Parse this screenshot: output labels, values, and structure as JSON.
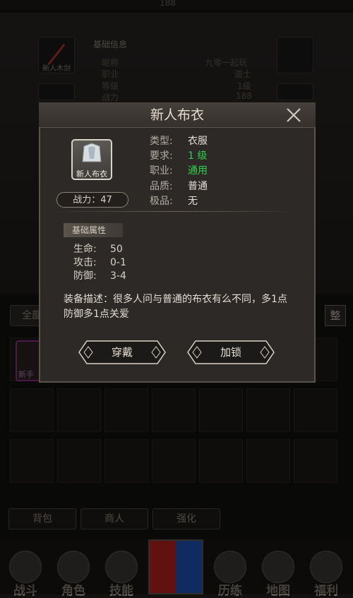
{
  "background": {
    "topbar_number": "188",
    "info_heading": "基础信息",
    "info_rows": [
      {
        "label": "昵称",
        "value": "九零一起玩"
      },
      {
        "label": "职业",
        "value": "道士"
      },
      {
        "label": "等级",
        "value": "1级"
      },
      {
        "label": "战力",
        "value": "188"
      }
    ],
    "weapon_slot_label": "新人木剑",
    "filter_button": "全部",
    "sort_button": "整",
    "bag_item_label": "新手",
    "tabs": [
      "背包",
      "商人",
      "强化"
    ],
    "nav": [
      "战斗",
      "角色",
      "技能",
      "历练",
      "地图",
      "福利"
    ]
  },
  "modal": {
    "title": "新人布衣",
    "item_icon_label": "新人布衣",
    "power": "战力：47",
    "properties": [
      {
        "key": "类型:",
        "value": "衣服",
        "highlight": false
      },
      {
        "key": "要求:",
        "value": "1 级",
        "highlight": true
      },
      {
        "key": "职业:",
        "value": "通用",
        "highlight": true
      },
      {
        "key": "品质:",
        "value": "普通",
        "highlight": false
      },
      {
        "key": "极品:",
        "value": "无",
        "highlight": false
      }
    ],
    "attributes_title": "基础属性",
    "attributes": [
      {
        "key": "生命:",
        "value": "50"
      },
      {
        "key": "攻击:",
        "value": "0-1"
      },
      {
        "key": "防御:",
        "value": "3-4"
      }
    ],
    "description": "装备描述：很多人问与普通的布衣有么不同，多1点防御多1点关爱",
    "buttons": {
      "equip": "穿戴",
      "lock": "加锁"
    },
    "colors": {
      "green": "#2fd14a",
      "panel": "#2c2926"
    }
  }
}
